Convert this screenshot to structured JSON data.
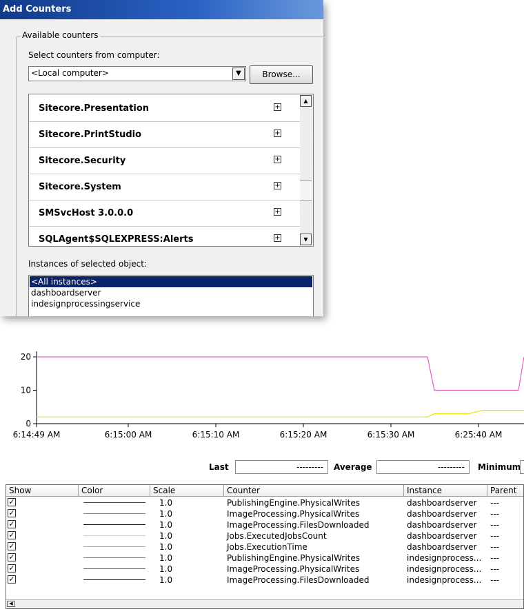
{
  "dialog": {
    "title": "Add Counters",
    "group_label": "Available counters",
    "select_label": "Select counters from computer:",
    "computer_value": "<Local computer>",
    "browse_label": "Browse...",
    "objects": [
      "Sitecore.Presentation",
      "Sitecore.PrintStudio",
      "Sitecore.Security",
      "Sitecore.System",
      "SMSvcHost 3.0.0.0",
      "SQLAgent$SQLEXPRESS:Alerts"
    ],
    "instances_label": "Instances of selected object:",
    "instances": [
      "<All instances>",
      "dashboardserver",
      "indesignprocessingservice"
    ],
    "selected_instance": "<All instances>"
  },
  "chart_data": {
    "type": "line",
    "y_ticks": [
      "20",
      "10",
      "0"
    ],
    "ylim": [
      0,
      20
    ],
    "x_ticks": [
      "6:14:49 AM",
      "6:15:00 AM",
      "6:15:10 AM",
      "6:15:20 AM",
      "6:15:30 AM",
      "6:25:40 AM"
    ],
    "series": [
      {
        "color": "#e060c0",
        "values": [
          20,
          20,
          20,
          20,
          20,
          20,
          20,
          20,
          20,
          20,
          20,
          20,
          10,
          10,
          10,
          10,
          20
        ]
      },
      {
        "color": "#e8e800",
        "values": [
          2,
          2,
          2,
          2,
          2,
          2,
          2,
          2,
          2,
          2,
          2,
          2,
          3,
          3,
          4,
          4,
          4
        ]
      }
    ]
  },
  "stats": {
    "last_label": "Last",
    "last_value": "---------",
    "average_label": "Average",
    "average_value": "---------",
    "minimum_label": "Minimum"
  },
  "table": {
    "headers": [
      "Show",
      "Color",
      "Scale",
      "Counter",
      "Instance",
      "Parent"
    ],
    "rows": [
      {
        "color": "#ff0000",
        "scale": "1.0",
        "counter": "PublishingEngine.PhysicalWrites",
        "instance": "dashboardserver",
        "parent": "---"
      },
      {
        "color": "#00e000",
        "scale": "1.0",
        "counter": "ImageProcessing.PhysicalWrites",
        "instance": "dashboardserver",
        "parent": "---"
      },
      {
        "color": "#0000e0",
        "scale": "1.0",
        "counter": "ImageProcessing.FilesDownloaded",
        "instance": "dashboardserver",
        "parent": "---"
      },
      {
        "color": "#e8e800",
        "scale": "1.0",
        "counter": "Jobs.ExecutedJobsCount",
        "instance": "dashboardserver",
        "parent": "---"
      },
      {
        "color": "#f08cc8",
        "scale": "1.0",
        "counter": "Jobs.ExecutionTime",
        "instance": "dashboardserver",
        "parent": "---"
      },
      {
        "color": "#20b0e8",
        "scale": "1.0",
        "counter": "PublishingEngine.PhysicalWrites",
        "instance": "indesignprocess...",
        "parent": "---"
      },
      {
        "color": "#ff00ff",
        "scale": "1.0",
        "counter": "ImageProcessing.PhysicalWrites",
        "instance": "indesignprocess...",
        "parent": "---"
      },
      {
        "color": "#800080",
        "scale": "1.0",
        "counter": "ImageProcessing.FilesDownloaded",
        "instance": "indesignprocess...",
        "parent": "---"
      }
    ]
  }
}
